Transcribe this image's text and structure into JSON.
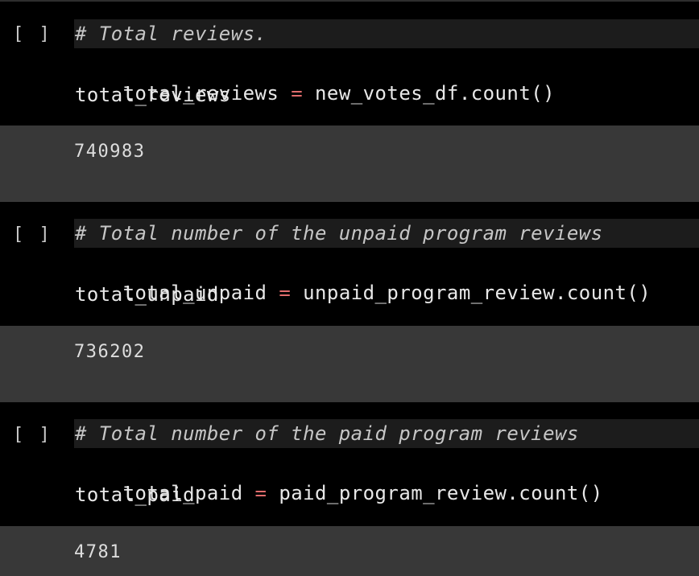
{
  "cells": [
    {
      "run_marker": "[ ]",
      "comment": "# Total reviews.",
      "assign_var": "total_reviews",
      "assign_op": "=",
      "assign_expr": "new_votes_df.count()",
      "last_expr": "total_reviews",
      "output": "740983"
    },
    {
      "run_marker": "[ ]",
      "comment": "# Total number of the unpaid program reviews",
      "assign_var": "total_unpaid",
      "assign_op": "=",
      "assign_expr": "unpaid_program_review.count()",
      "last_expr": "total_unpaid",
      "output": "736202"
    },
    {
      "run_marker": "[ ]",
      "comment": "# Total number of the paid program reviews",
      "assign_var": "total_paid",
      "assign_op": "=",
      "assign_expr": "paid_program_review.count()",
      "last_expr": "total_paid",
      "output": "4781"
    }
  ],
  "colors": {
    "cell_background": "#000000",
    "output_background": "#383838",
    "comment_highlight": "#1c1c1c",
    "operator": "#e06c6c",
    "text": "#e8e8e8"
  }
}
